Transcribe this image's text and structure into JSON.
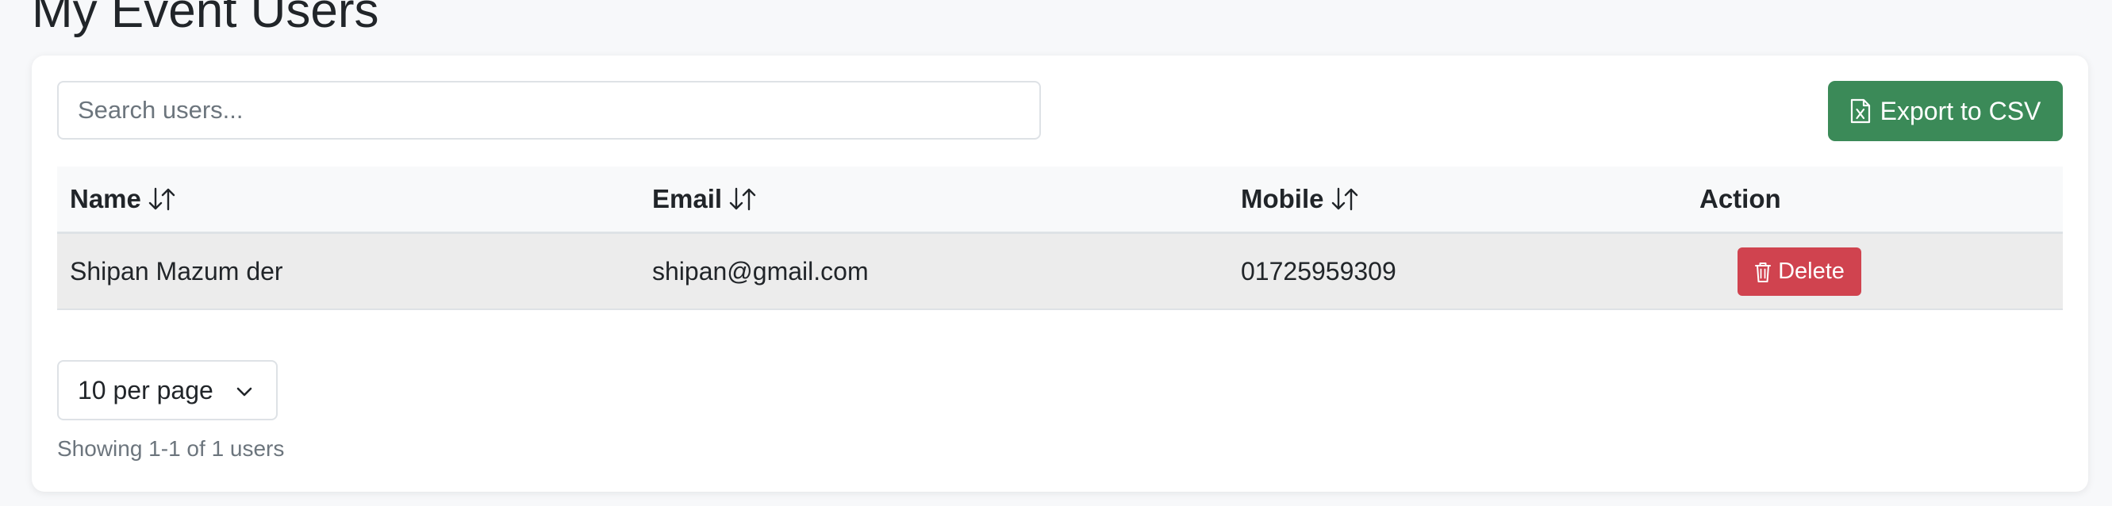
{
  "page": {
    "title": "My Event Users"
  },
  "search": {
    "placeholder": "Search users..."
  },
  "toolbar": {
    "export_label": "Export to CSV",
    "export_icon": "file-excel-icon",
    "export_color": "#3b8a58"
  },
  "table": {
    "columns": [
      {
        "label": "Name",
        "sortable": true
      },
      {
        "label": "Email",
        "sortable": true
      },
      {
        "label": "Mobile",
        "sortable": true
      },
      {
        "label": "Action",
        "sortable": false
      }
    ],
    "rows": [
      {
        "name": "Shipan Mazum der",
        "email": "shipan@gmail.com",
        "mobile": "01725959309",
        "action_label": "Delete"
      }
    ],
    "delete_color": "#d0434f",
    "delete_icon": "trash-icon",
    "sort_icon": "sort-arrows-icon"
  },
  "pagination": {
    "per_page_selected": "10 per page",
    "showing": "Showing 1-1 of 1 users"
  }
}
